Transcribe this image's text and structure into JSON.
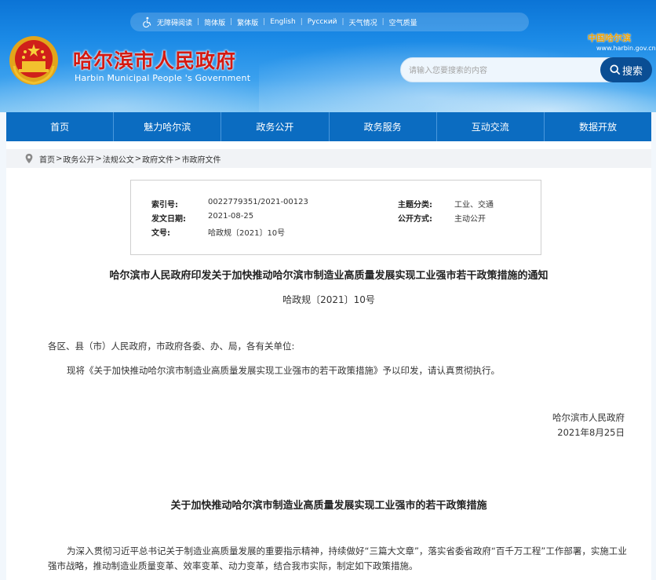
{
  "topbar": {
    "links": [
      "无障碍阅读",
      "简体版",
      "繁体版",
      "English",
      "Русский",
      "天气情况",
      "空气质量"
    ]
  },
  "header": {
    "title": "哈尔滨市人民政府",
    "subtitle": "Harbin Municipal People 's Government",
    "china_logo": "中国哈尔滨",
    "china_url": "www.harbin.gov.cn"
  },
  "search": {
    "placeholder": "请输入您要搜索的内容",
    "button_label": "搜索"
  },
  "nav": {
    "items": [
      "首页",
      "魅力哈尔滨",
      "政务公开",
      "政务服务",
      "互动交流",
      "数据开放"
    ]
  },
  "breadcrumb": [
    "首页",
    "政务公开",
    "法规公文",
    "政府文件",
    "市政府文件"
  ],
  "meta": {
    "index_label": "索引号:",
    "index_value": "0022779351/2021-00123",
    "topic_label": "主题分类:",
    "topic_value": "工业、交通",
    "date_label": "发文日期:",
    "date_value": "2021-08-25",
    "public_label": "公开方式:",
    "public_value": "主动公开",
    "docno_label": "文号:",
    "docno_value": "哈政规〔2021〕10号"
  },
  "document": {
    "title": "哈尔滨市人民政府印发关于加快推动哈尔滨市制造业高质量发展实现工业强市若干政策措施的通知",
    "number": "哈政规〔2021〕10号",
    "addressee": "各区、县（市）人民政府，市政府各委、办、局，各有关单位:",
    "body": "现将《关于加快推动哈尔滨市制造业高质量发展实现工业强市的若干政策措施》予以印发，请认真贯彻执行。",
    "sign_org": "哈尔滨市人民政府",
    "sign_date": "2021年8月25日",
    "sub_title": "关于加快推动哈尔滨市制造业高质量发展实现工业强市的若干政策措施",
    "para_2": "为深入贯彻习近平总书记关于制造业高质量发展的重要指示精神，持续做好“三篇大文章”，落实省委省政府“百千万工程”工作部署，实施工业强市战略，推动制造业质量变革、效率变革、动力变革，结合我市实际，制定如下政策措施。"
  },
  "colors": {
    "header_blue": "#1b8ae6",
    "nav_blue": "#0b6cc1",
    "title_red": "#d41a12",
    "search_button": "#0a4e94"
  }
}
